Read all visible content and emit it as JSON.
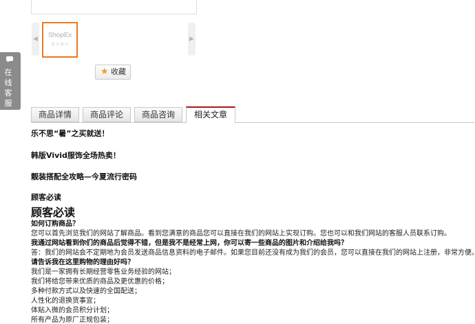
{
  "gallery": {
    "thumbnail_logo": "ShopEx",
    "thumbnail_sub": "暂 无 图 片",
    "prev_arrow": "◀",
    "next_arrow": "▶"
  },
  "favorite": {
    "label": "收藏",
    "star": "★"
  },
  "side_service": {
    "label": "在\n线\n客\n服"
  },
  "tabs": [
    {
      "label": "商品详情"
    },
    {
      "label": "商品评论"
    },
    {
      "label": "商品咨询"
    },
    {
      "label": "相关文章"
    }
  ],
  "articles": [
    {
      "title": "乐不思“暑”之买就送！"
    },
    {
      "title": "韩版Vivid服饰全场热卖！"
    },
    {
      "title": "靓装搭配全攻略—今夏流行密码"
    },
    {
      "title": "顾客必读"
    }
  ],
  "notice": {
    "heading": "顾客必读",
    "lines": [
      {
        "kind": "q",
        "text": "如何订购商品？"
      },
      {
        "kind": "p",
        "text": "您可以首先浏览我们的网站了解商品。看到您满意的商品您可以直接在我们的网站上实现订购。您也可以和我们网站的客服人员联系订购。"
      },
      {
        "kind": "q",
        "text": "我通过网站看到你们的商品后觉得不错，但是我不是经常上网，你可以寄一些商品的图片和介绍给我吗？"
      },
      {
        "kind": "p",
        "text": "答：我们的网站会不定期地为会员发送商品信息资料的电子邮件。如果您目前还没有成为我们的会员，您可以直接在我们的网站上注册，非常方便。"
      },
      {
        "kind": "q",
        "text": "请告诉我在这里购物的理由好吗？"
      },
      {
        "kind": "p",
        "text": "我们是一家拥有长期经营零售业务经验的网站；"
      },
      {
        "kind": "p",
        "text": "我们将给您带来优质的商品及更优惠的价格；"
      },
      {
        "kind": "p",
        "text": "多种付款方式以及快速的全国配送；"
      },
      {
        "kind": "p",
        "text": "人性化的退换货事宜；"
      },
      {
        "kind": "p",
        "text": "体贴入微的会员积分计划；"
      },
      {
        "kind": "p",
        "text": "所有产品为原厂正规包装；"
      }
    ]
  },
  "colors": {
    "accent": "#a31818",
    "thumb_border": "#f0761d",
    "side_tab": "#8b8b8b"
  }
}
